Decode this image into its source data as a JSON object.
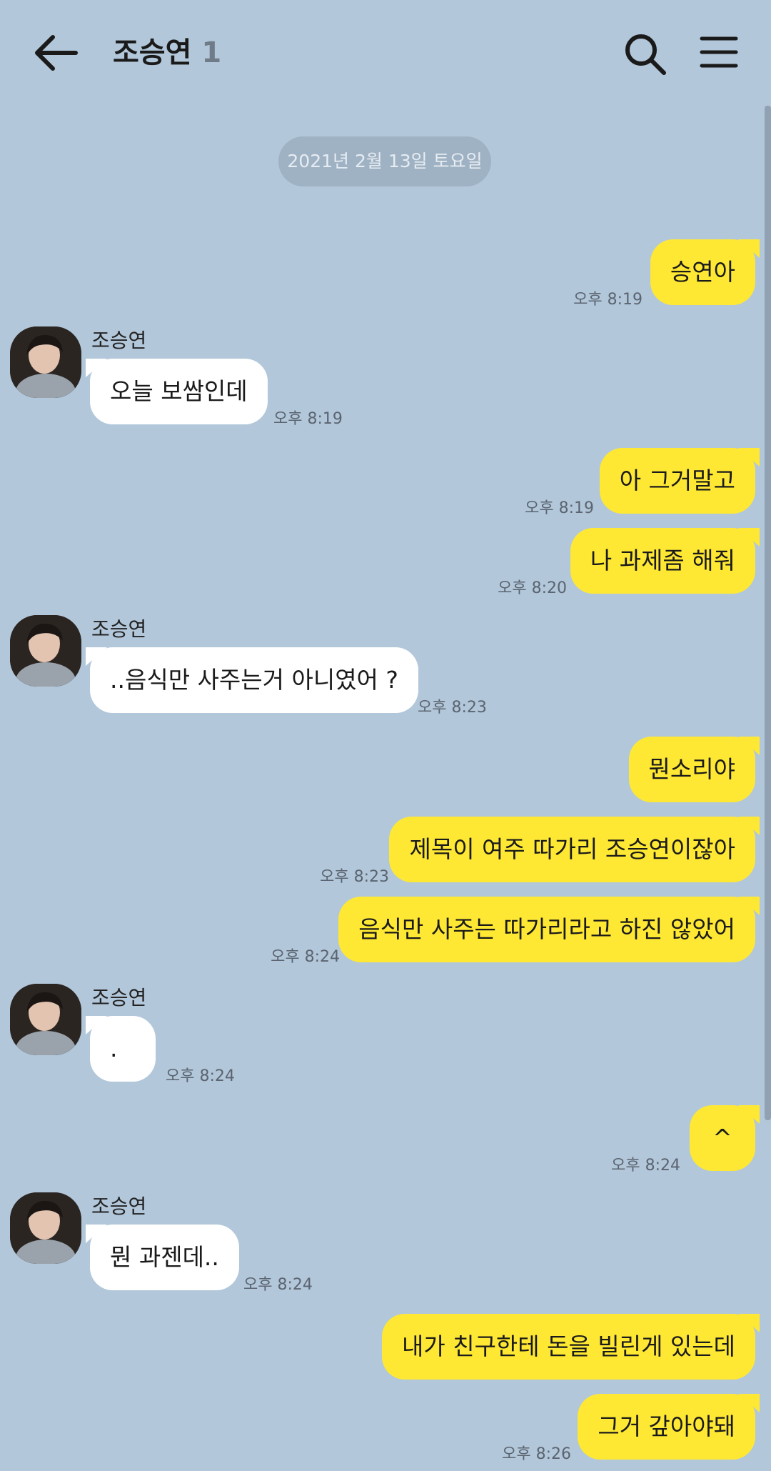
{
  "header": {
    "title": "조승연",
    "member_count": "1",
    "icons": [
      "back-arrow-icon",
      "search-icon",
      "menu-icon"
    ]
  },
  "date_divider": "2021년 2월 13일 토요일",
  "colors": {
    "background": "#b2c7da",
    "my_bubble": "#fee834",
    "their_bubble": "#ffffff",
    "date_pill": "#9fb2c3"
  },
  "messages": [
    {
      "from": "me",
      "text": "승연아",
      "time": "오후 8:19"
    },
    {
      "from": "them",
      "sender": "조승연",
      "text": "오늘 보쌈인데",
      "time": "오후 8:19"
    },
    {
      "from": "me",
      "text": "아 그거말고",
      "time": "오후 8:19"
    },
    {
      "from": "me",
      "text": "나 과제좀 해줘",
      "time": "오후 8:20"
    },
    {
      "from": "them",
      "sender": "조승연",
      "text": "..음식만 사주는거 아니였어 ?",
      "time": "오후 8:23"
    },
    {
      "from": "me",
      "text": "뭔소리야",
      "time": ""
    },
    {
      "from": "me",
      "text": "제목이 여주 따가리 조승연이잖아",
      "time": "오후 8:23"
    },
    {
      "from": "me",
      "text": "음식만 사주는 따가리라고 하진 않았어",
      "time": "오후 8:24"
    },
    {
      "from": "them",
      "sender": "조승연",
      "text": ".",
      "time": "오후 8:24"
    },
    {
      "from": "me",
      "text": "^",
      "time": "오후 8:24"
    },
    {
      "from": "them",
      "sender": "조승연",
      "text": "뭔 과젠데..",
      "time": "오후 8:24"
    },
    {
      "from": "me",
      "text": "내가 친구한테 돈을 빌린게 있는데",
      "time": ""
    },
    {
      "from": "me",
      "text": "그거 갚아야돼",
      "time": "오후 8:26"
    }
  ]
}
